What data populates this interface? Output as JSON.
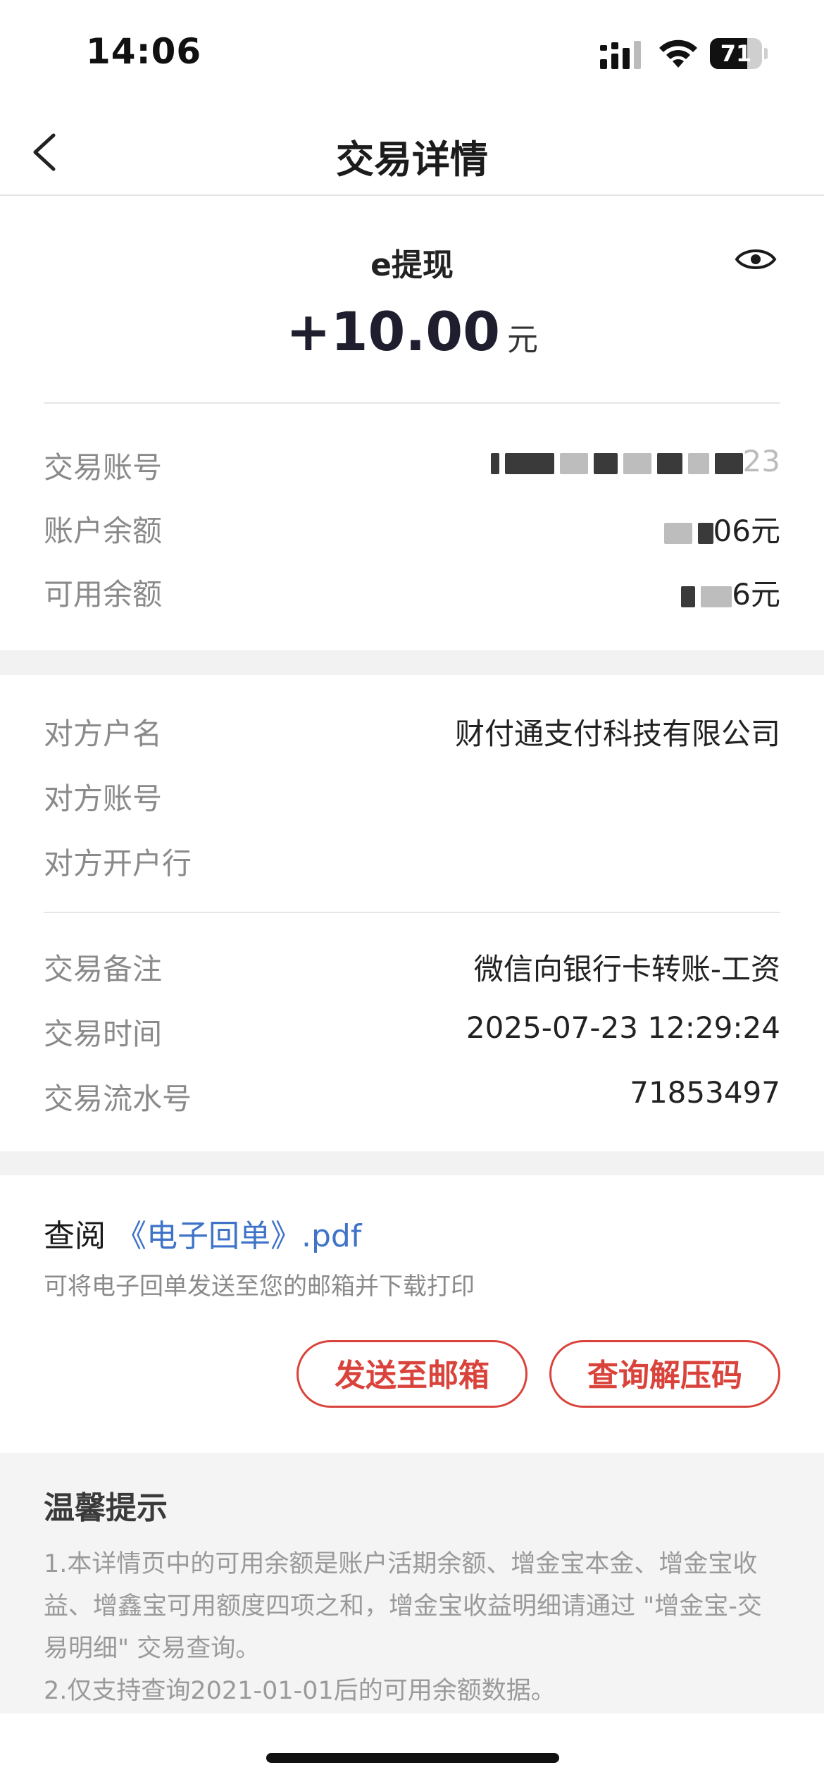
{
  "status_bar": {
    "time": "14:06",
    "battery": "71",
    "battery_level": 0.71
  },
  "nav": {
    "title": "交易详情",
    "back_icon": "chevron-left-icon"
  },
  "summary": {
    "type": "e提现",
    "amount": "+10.00",
    "unit": "元",
    "eye_icon": "eye-icon"
  },
  "account_rows": [
    {
      "label": "交易账号",
      "value": "23"
    },
    {
      "label": "账户余额",
      "value": "06元"
    },
    {
      "label": "可用余额",
      "value": "6元"
    }
  ],
  "counterparty": [
    {
      "label": "对方户名",
      "value": "财付通支付科技有限公司"
    },
    {
      "label": "对方账号",
      "value": ""
    },
    {
      "label": "对方开户行",
      "value": ""
    }
  ],
  "details": [
    {
      "label": "交易备注",
      "value": "微信向银行卡转账-工资"
    },
    {
      "label": "交易时间",
      "value": "2025-07-23 12:29:24"
    },
    {
      "label": "交易流水号",
      "value": "71853497"
    }
  ],
  "receipt": {
    "view_label": "查阅",
    "link": "《电子回单》.pdf",
    "hint": "可将电子回单发送至您的邮箱并下载打印",
    "send_button": "发送至邮箱",
    "query_button": "查询解压码"
  },
  "tips": {
    "title": "温馨提示",
    "line1": "1.本详情页中的可用余额是账户活期余额、增金宝本金、增金宝收益、增鑫宝可用额度四项之和，增金宝收益明细请通过 \"增金宝-交易明细\" 交易查询。",
    "line2": "2.仅支持查询2021-01-01后的可用余额数据。"
  },
  "colors": {
    "accent_red": "#d9433b",
    "link_blue": "#3f73c8"
  }
}
